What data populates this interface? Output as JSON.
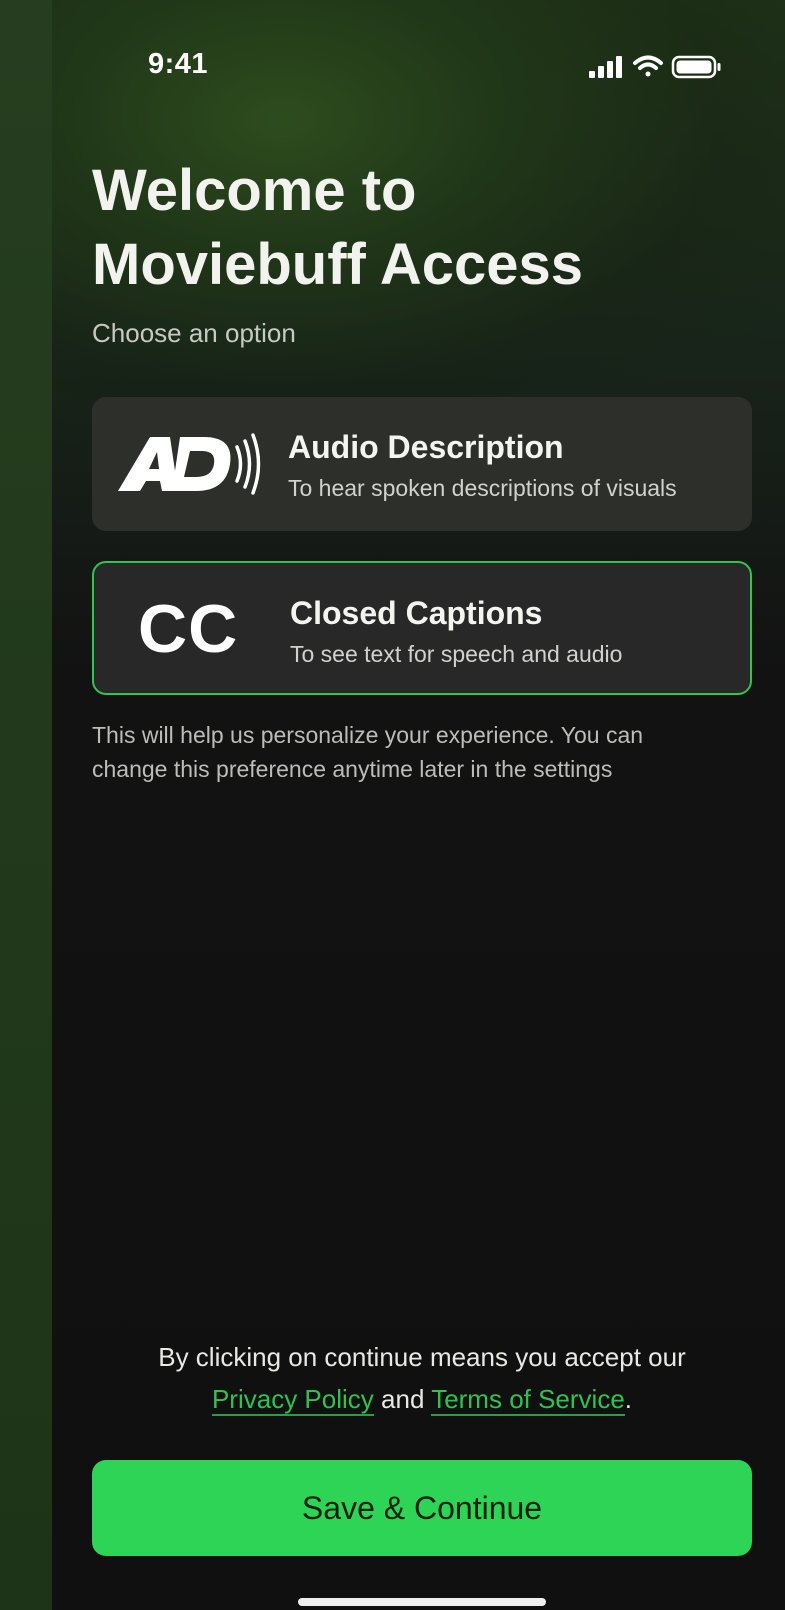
{
  "status_bar": {
    "time": "9:41",
    "icons": [
      "signal-icon",
      "wifi-icon",
      "battery-icon"
    ]
  },
  "header": {
    "title_line1": "Welcome to",
    "title_line2": "Moviebuff Access",
    "subtitle": "Choose an option"
  },
  "options": [
    {
      "icon": "audio-description-icon",
      "title": "Audio Description",
      "description": "To hear spoken descriptions of visuals",
      "selected": false
    },
    {
      "icon": "closed-captions-icon",
      "icon_text": "CC",
      "title": "Closed Captions",
      "description": "To see text for speech and audio",
      "selected": true
    }
  ],
  "helper": {
    "line1": "This will help us personalize your experience. You can",
    "line2": "change this preference anytime later in the settings"
  },
  "legal": {
    "line1": "By clicking on continue means you accept our",
    "privacy_link": "Privacy Policy",
    "conjunction": "and",
    "terms_link": "Terms of Service",
    "end": "."
  },
  "cta": {
    "label": "Save & Continue"
  },
  "colors": {
    "accent": "#2ed455",
    "selected_border": "#32c451",
    "link": "#2fc24f",
    "background": "#121212",
    "card": "#2c2c2b"
  }
}
